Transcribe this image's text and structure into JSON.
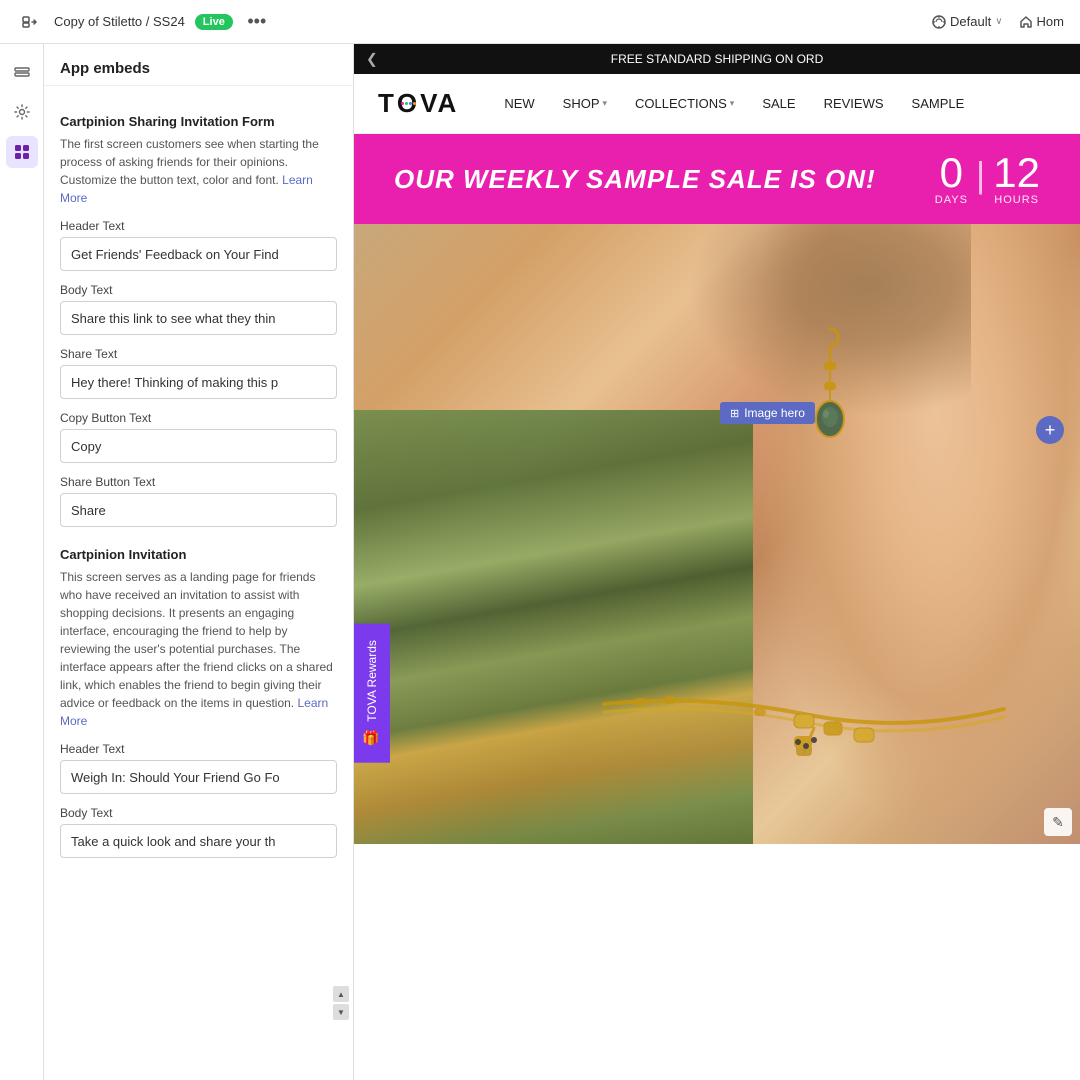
{
  "topbar": {
    "back_icon": "◁",
    "breadcrumb": "Copy of Stiletto / SS24",
    "live_label": "Live",
    "dots_icon": "•••",
    "default_label": "Default",
    "default_chevron": "∨",
    "home_icon": "⌂",
    "home_label": "Hom"
  },
  "sidebar_icons": [
    {
      "name": "layers-icon",
      "symbol": "⊞",
      "active": false
    },
    {
      "name": "settings-icon",
      "symbol": "⚙",
      "active": false
    },
    {
      "name": "apps-icon",
      "symbol": "⊡",
      "active": true
    }
  ],
  "panel": {
    "title": "App embeds",
    "section1": {
      "title": "Cartpinion Sharing Invitation Form",
      "description": "The first screen customers see when starting the process of asking friends for their opinions. Customize the button text, color and font.",
      "learn_more": "Learn More",
      "fields": [
        {
          "label": "Header Text",
          "value": "Get Friends' Feedback on Your Find"
        },
        {
          "label": "Body Text",
          "value": "Share this link to see what they thin"
        },
        {
          "label": "Share Text",
          "value": "Hey there! Thinking of making this p"
        },
        {
          "label": "Copy Button Text",
          "value": "Copy"
        },
        {
          "label": "Share Button Text",
          "value": "Share"
        }
      ]
    },
    "section2": {
      "title": "Cartpinion Invitation",
      "description": "This screen serves as a landing page for friends who have received an invitation to assist with shopping decisions. It presents an engaging interface, encouraging the friend to help by reviewing the user's potential purchases. The interface appears after the friend clicks on a shared link, which enables the friend to begin giving their advice or feedback on the items in question.",
      "learn_more": "Learn More",
      "fields": [
        {
          "label": "Header Text",
          "value": "Weigh In: Should Your Friend Go Fo"
        },
        {
          "label": "Body Text",
          "value": "Take a quick look and share your th"
        }
      ]
    }
  },
  "store": {
    "announcement": "FREE STANDARD SHIPPING ON ORD",
    "announcement_arrow": "❮",
    "logo": "TOVA",
    "nav_links": [
      {
        "label": "NEW",
        "has_chevron": false
      },
      {
        "label": "SHOP",
        "has_chevron": true
      },
      {
        "label": "COLLECTIONS",
        "has_chevron": true
      },
      {
        "label": "SALE",
        "has_chevron": false
      },
      {
        "label": "REVIEWS",
        "has_chevron": false
      },
      {
        "label": "SAMPLE",
        "has_chevron": false
      }
    ],
    "sale_banner": {
      "text": "OUR WEEKLY SAMPLE SALE IS ON!",
      "countdown_days_num": "0",
      "countdown_days_label": "DAYS",
      "countdown_sep": "|",
      "countdown_hours_num": "12",
      "countdown_hours_label": "HOURS"
    },
    "image_hero_label": "Image hero",
    "grid_icon": "⊞",
    "add_icon": "+",
    "rewards_label": "TOVA Rewards",
    "rewards_icon": "🎁",
    "edit_icon": "✎"
  },
  "colors": {
    "pink": "#e91fad",
    "purple": "#7c3aed",
    "nav_purple": "#5c6ac4",
    "live_green": "#22c55e",
    "gold": "#c8960a"
  }
}
